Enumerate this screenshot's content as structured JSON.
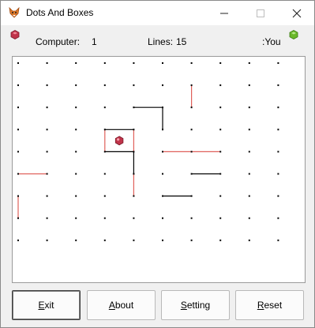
{
  "window": {
    "title": "Dots And Boxes",
    "controls": [
      "minimize",
      "maximize",
      "close"
    ]
  },
  "status": {
    "computer_label": "Computer:",
    "computer_score": "1",
    "lines_label": "Lines:",
    "lines_count": "15",
    "you_label": ":You",
    "computer_color": "#c0344a",
    "you_color": "#6ab82a"
  },
  "board": {
    "dot_columns": 10,
    "dot_rows": 9,
    "line_colors": {
      "computer": "#e0605a",
      "player": "#000000"
    },
    "lines": [
      {
        "from": [
          4,
          2
        ],
        "to": [
          5,
          2
        ],
        "owner": "player"
      },
      {
        "from": [
          5,
          2
        ],
        "to": [
          5,
          3
        ],
        "owner": "player"
      },
      {
        "from": [
          6,
          1
        ],
        "to": [
          6,
          2
        ],
        "owner": "computer"
      },
      {
        "from": [
          3,
          3
        ],
        "to": [
          4,
          3
        ],
        "owner": "player"
      },
      {
        "from": [
          3,
          3
        ],
        "to": [
          3,
          4
        ],
        "owner": "computer"
      },
      {
        "from": [
          4,
          3
        ],
        "to": [
          4,
          4
        ],
        "owner": "computer"
      },
      {
        "from": [
          3,
          4
        ],
        "to": [
          4,
          4
        ],
        "owner": "player"
      },
      {
        "from": [
          5,
          4
        ],
        "to": [
          7,
          4
        ],
        "owner": "computer"
      },
      {
        "from": [
          4,
          4
        ],
        "to": [
          4,
          5
        ],
        "owner": "player"
      },
      {
        "from": [
          4,
          5
        ],
        "to": [
          4,
          6
        ],
        "owner": "computer"
      },
      {
        "from": [
          6,
          5
        ],
        "to": [
          7,
          5
        ],
        "owner": "player"
      },
      {
        "from": [
          0,
          5
        ],
        "to": [
          1,
          5
        ],
        "owner": "computer"
      },
      {
        "from": [
          5,
          6
        ],
        "to": [
          6,
          6
        ],
        "owner": "player"
      },
      {
        "from": [
          0,
          6
        ],
        "to": [
          0,
          7
        ],
        "owner": "computer"
      }
    ],
    "boxes": [
      {
        "col": 3,
        "row": 3,
        "owner": "computer"
      }
    ]
  },
  "buttons": {
    "exit": {
      "mnemonic": "E",
      "rest": "xit"
    },
    "about": {
      "mnemonic": "A",
      "rest": "bout"
    },
    "setting": {
      "mnemonic": "S",
      "rest": "etting"
    },
    "reset": {
      "mnemonic": "R",
      "rest": "eset"
    }
  }
}
